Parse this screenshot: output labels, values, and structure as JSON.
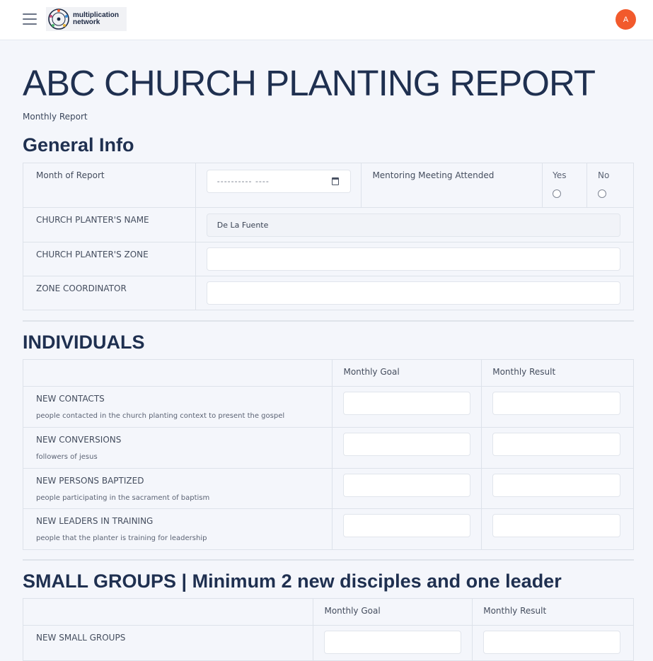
{
  "header": {
    "logo_line1": "multiplication",
    "logo_line2": "network",
    "avatar_initial": "A"
  },
  "page": {
    "title": "ABC CHURCH PLANTING REPORT",
    "subtitle": "Monthly Report"
  },
  "general_info": {
    "title": "General Info",
    "month_label": "Month of Report",
    "month_placeholder": "---------- ----",
    "mentoring_label": "Mentoring Meeting Attended",
    "yes_label": "Yes",
    "no_label": "No",
    "planter_name_label": "CHURCH PLANTER'S NAME",
    "planter_name_value": "De La Fuente",
    "planter_zone_label": "CHURCH PLANTER'S ZONE",
    "zone_coordinator_label": "ZONE COORDINATOR"
  },
  "individuals": {
    "title": "INDIVIDUALS",
    "goal_header": "Monthly Goal",
    "result_header": "Monthly Result",
    "rows": [
      {
        "label": "NEW CONTACTS",
        "desc": "people contacted in the church planting context to present the gospel"
      },
      {
        "label": "NEW CONVERSIONS",
        "desc": "followers of jesus"
      },
      {
        "label": "NEW PERSONS BAPTIZED",
        "desc": "people participating in the sacrament of baptism"
      },
      {
        "label": "NEW LEADERS IN TRAINING",
        "desc": "people that the planter is training for leadership"
      }
    ]
  },
  "small_groups": {
    "title": "SMALL GROUPS | Minimum 2 new disciples and one leader",
    "goal_header": "Monthly Goal",
    "result_header": "Monthly Result",
    "rows": [
      {
        "label": "NEW SMALL GROUPS"
      }
    ]
  },
  "colors": {
    "accent": "#f25a2c",
    "heading": "#1f3050",
    "background": "#f4f6fb"
  }
}
